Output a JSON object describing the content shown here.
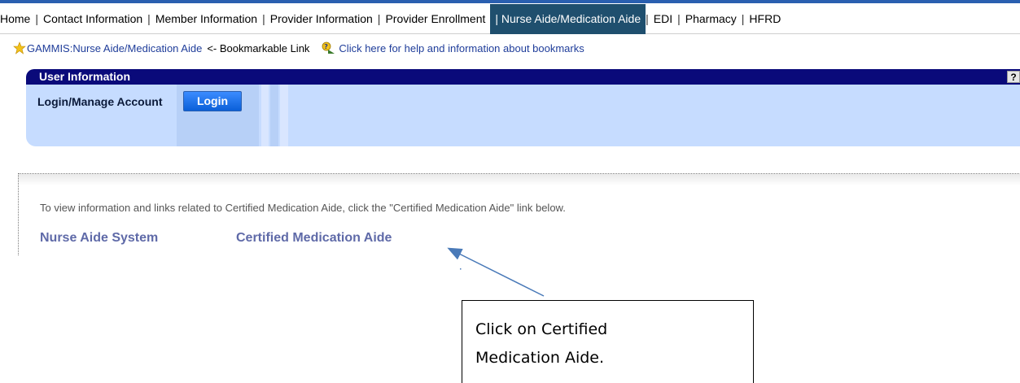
{
  "nav": {
    "items": [
      "Home",
      "Contact Information",
      "Member Information",
      "Provider Information",
      "Provider Enrollment",
      "Nurse Aide/Medication Aide",
      "EDI",
      "Pharmacy",
      "HFRD"
    ],
    "active_index": 5,
    "separator": "|"
  },
  "bookmark": {
    "link_text": "GAMMIS:Nurse Aide/Medication Aide",
    "suffix_text": "<- Bookmarkable Link",
    "help_text": "Click here for help and information about bookmarks",
    "star_icon": "star-icon",
    "help_icon": "bookmark-help-icon"
  },
  "user_info": {
    "title": "User Information",
    "help_label": "?",
    "login_label": "Login/Manage Account",
    "login_button": "Login"
  },
  "panel": {
    "instruction": "To view information and links related to Certified Medication Aide, click the \"Certified Medication Aide\" link below.",
    "links": [
      "Nurse Aide System",
      "Certified Medication Aide"
    ]
  },
  "callout": {
    "line1": "Click on Certified",
    "line2": "Medication Aide."
  },
  "colors": {
    "nav_active_bg": "#1f4f6e",
    "header_bg": "#0a0a7a",
    "box_bg": "#c6dcff",
    "link_color": "#5f6aa8",
    "arrow_color": "#4a7ab8"
  }
}
